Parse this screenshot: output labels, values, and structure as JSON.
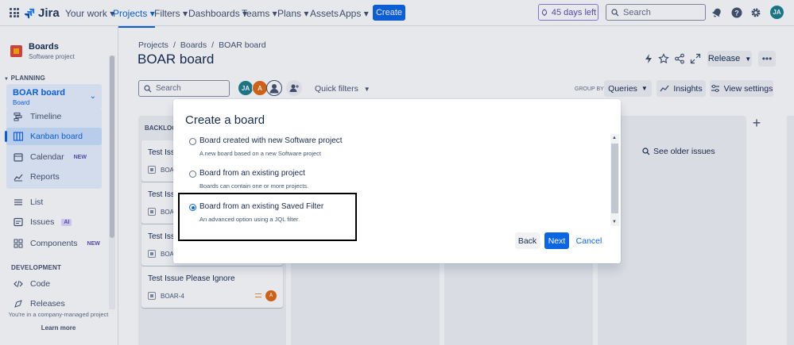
{
  "topnav": {
    "app_name": "Jira",
    "items": [
      "Your work",
      "Projects",
      "Filters",
      "Dashboards",
      "Teams",
      "Plans",
      "Assets",
      "Apps"
    ],
    "active_item": "Projects",
    "create_label": "Create",
    "trial_label": "45 days left",
    "search_placeholder": "Search",
    "avatar_initials": "JA"
  },
  "sidebar": {
    "project_name": "Boards",
    "project_type": "Software project",
    "planning_heading": "PLANNING",
    "board_name": "BOAR board",
    "board_subtitle": "Board",
    "items": [
      {
        "label": "Timeline",
        "icon": "timeline-icon"
      },
      {
        "label": "Kanban board",
        "icon": "board-icon"
      },
      {
        "label": "Calendar",
        "icon": "calendar-icon",
        "badge": "NEW"
      },
      {
        "label": "Reports",
        "icon": "reports-icon"
      },
      {
        "label": "List",
        "icon": "list-icon"
      },
      {
        "label": "Issues",
        "icon": "issues-icon",
        "badge": "AI"
      },
      {
        "label": "Components",
        "icon": "components-icon",
        "badge": "NEW"
      }
    ],
    "development_heading": "DEVELOPMENT",
    "dev_items": [
      {
        "label": "Code",
        "icon": "code-icon"
      },
      {
        "label": "Releases",
        "icon": "releases-icon"
      }
    ],
    "footer_text": "You're in a company-managed project",
    "footer_link": "Learn more"
  },
  "header": {
    "breadcrumbs": [
      "Projects",
      "Boards",
      "BOAR board"
    ],
    "title": "BOAR board",
    "release_label": "Release"
  },
  "toolbar": {
    "search_placeholder": "Search",
    "avatars": [
      "JA",
      "A"
    ],
    "quick_filters_label": "Quick filters",
    "group_by_label": "GROUP BY",
    "queries_label": "Queries",
    "insights_label": "Insights",
    "view_settings_label": "View settings"
  },
  "board": {
    "backlog_heading": "BACKLOG",
    "cards": [
      {
        "title": "Test Issue",
        "key": "BOAR"
      },
      {
        "title": "Test Issue",
        "key": "BOAR"
      },
      {
        "title": "Test Issue",
        "key": "BOAR"
      },
      {
        "title": "Test Issue Please Ignore",
        "key": "BOAR-4",
        "assignee": "A"
      }
    ],
    "see_older_label": "See older issues"
  },
  "modal": {
    "title": "Create a board",
    "options": [
      {
        "label": "Board created with new Software project",
        "description": "A new board based on a new Software project",
        "selected": false
      },
      {
        "label": "Board from an existing project",
        "description": "Boards can contain one or more projects.",
        "selected": false
      },
      {
        "label": "Board from an existing Saved Filter",
        "description": "An advanced option using a JQL filter.",
        "selected": true
      }
    ],
    "back_label": "Back",
    "next_label": "Next",
    "cancel_label": "Cancel"
  },
  "colors": {
    "accent": "#0c66e4",
    "selected_bg": "#e9f2ff",
    "trial_purple": "#5e4db2"
  }
}
